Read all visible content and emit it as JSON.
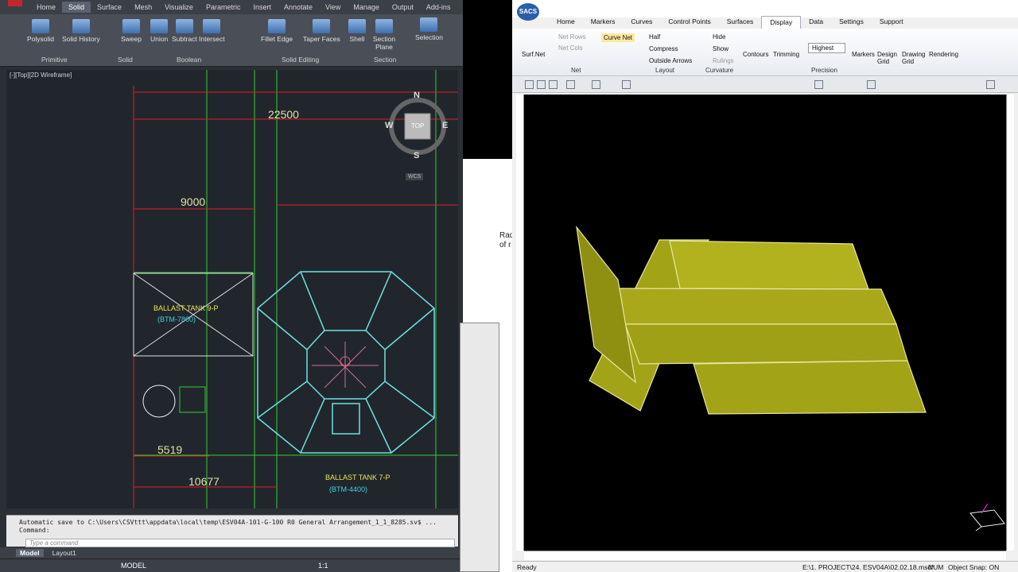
{
  "autocad": {
    "tabs": [
      "Home",
      "Solid",
      "Surface",
      "Mesh",
      "Visualize",
      "Parametric",
      "Insert",
      "Annotate",
      "View",
      "Manage",
      "Output",
      "Add-ins"
    ],
    "tools": {
      "polysolid": "Polysolid",
      "solid_history": "Solid History",
      "sweep": "Sweep",
      "union": "Union",
      "subtract": "Subtract",
      "intersect": "Intersect",
      "fillet_edge": "Fillet Edge",
      "taper_faces": "Taper Faces",
      "shell": "Shell",
      "section_plane": "Section Plane",
      "selection": "Selection"
    },
    "groups": {
      "primitive": "Primitive",
      "solid": "Solid",
      "boolean": "Boolean",
      "solid_editing": "Solid Editing",
      "section": "Section"
    },
    "viewport_label": "[-][Top][2D Wireframe]",
    "viewcube": {
      "n": "N",
      "s": "S",
      "e": "E",
      "w": "W",
      "top": "TOP",
      "wcs": "WCS"
    },
    "dims": {
      "d1": "22500",
      "d2": "9000",
      "d3": "5519",
      "d4": "10677"
    },
    "tanks": [
      {
        "name": "BALLAST TANK 9-P",
        "sub": "(BTM-7800)"
      },
      {
        "name": "BALLAST TANK 7-P",
        "sub": "(BTM-4400)"
      }
    ],
    "cmd_history": "Automatic save to C:\\Users\\CSVttt\\appdata\\local\\temp\\ESV04A-101-G-100 R0 General Arrangement_1_1_8285.sv$ ...",
    "cmd_prompt": "Command:",
    "cmd_placeholder": "Type a command",
    "layout_tabs": [
      "Model",
      "Layout1"
    ],
    "status_model": "MODEL",
    "status_scale": "1:1",
    "mid_text": [
      "Rad",
      "of r"
    ]
  },
  "maxsurf": {
    "logo": "SACS",
    "tabs": [
      "Home",
      "Markers",
      "Curves",
      "Control Points",
      "Surfaces",
      "Display",
      "Data",
      "Settings",
      "Support"
    ],
    "ribbon": {
      "surf_net": "Surf.Net",
      "net_rows": "Net Rows",
      "net_cols": "Net Cols",
      "curve_net": "Curve Net",
      "half": "Half",
      "compress": "Compress",
      "outside_arrows": "Outside Arrows",
      "hide": "Hide",
      "show": "Show",
      "rulings": "Rulings",
      "contours": "Contours",
      "trimming": "Trimming",
      "precision_value": "Highest",
      "markers": "Markers",
      "design_grid": "Design Grid",
      "drawing_grid": "Drawing Grid",
      "rendering": "Rendering"
    },
    "groups": {
      "net": "Net",
      "layout": "Layout",
      "curvature": "Curvature",
      "precision": "Precision"
    },
    "status": {
      "ready": "Ready",
      "file": "E:\\1. PROJECT\\24. ESV04A\\02.02.18.msd*",
      "num": "NUM",
      "snap": "Object Snap: ON"
    },
    "colors": {
      "surface": "#a3a317",
      "edge": "#e8e8a0"
    }
  }
}
